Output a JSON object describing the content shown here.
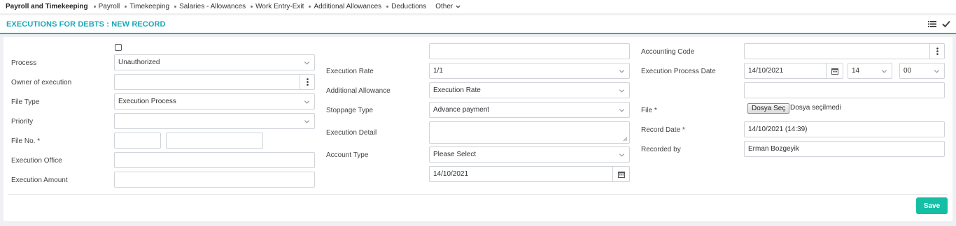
{
  "nav": {
    "brand": "Payroll and Timekeeping",
    "items": [
      "Payroll",
      "Timekeeping",
      "Salaries - Allowances",
      "Work Entry-Exit",
      "Additional Allowances",
      "Deductions"
    ],
    "other": "Other"
  },
  "header": {
    "title": "EXECUTIONS FOR DEBTS : NEW RECORD",
    "accent_color": "#21b4a6"
  },
  "form": {
    "left": {
      "process_label": "Process",
      "process_value": "Unauthorized",
      "owner_label": "Owner of execution",
      "owner_value": "",
      "file_type_label": "File Type",
      "file_type_value": "Execution Process",
      "priority_label": "Priority",
      "priority_value": "",
      "file_no_label": "File No. *",
      "file_no_value_1": "",
      "file_no_value_2": "",
      "office_label": "Execution Office",
      "office_value": "",
      "amount_label": "Execution Amount",
      "amount_value": ""
    },
    "middle": {
      "top_value": "",
      "rate_label": "Execution Rate",
      "rate_value": "1/1",
      "allowance_label": "Additional Allowance",
      "allowance_value": "Execution Rate",
      "stoppage_label": "Stoppage Type",
      "stoppage_value": "Advance payment",
      "detail_label": "Execution Detail",
      "detail_value": "",
      "account_label": "Account Type",
      "account_value": "Please Select",
      "date_value": "14/10/2021"
    },
    "right": {
      "accounting_label": "Accounting Code",
      "accounting_value": "",
      "process_date_label": "Execution Process Date",
      "process_date_value": "14/10/2021",
      "hour_value": "14",
      "minute_value": "00",
      "extra_value": "",
      "file_label": "File *",
      "file_button": "Dosya Seç",
      "file_status": "Dosya seçilmedi",
      "record_date_label": "Record Date *",
      "record_date_value": "14/10/2021 (14:39)",
      "recorded_by_label": "Recorded by",
      "recorded_by_value": "Erman Bozgeyik"
    }
  },
  "actions": {
    "save_label": "Save",
    "save_color": "#14bfa5"
  }
}
